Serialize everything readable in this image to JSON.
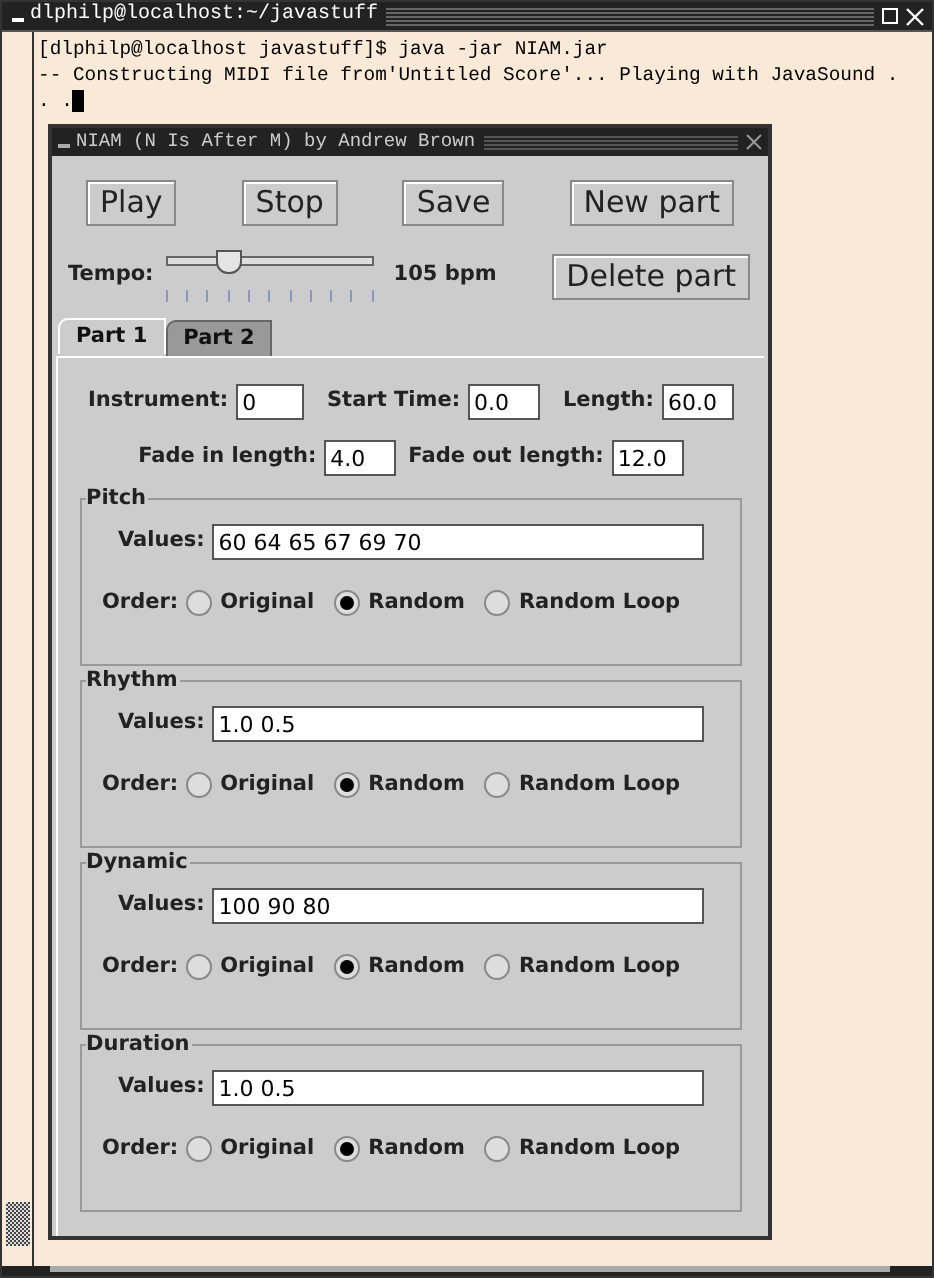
{
  "terminal": {
    "title": "dlphilp@localhost:~/javastuff",
    "lines": [
      "[dlphilp@localhost javastuff]$ java -jar NIAM.jar",
      "-- Constructing MIDI file from'Untitled Score'... Playing with JavaSound .",
      ". ."
    ]
  },
  "app": {
    "title": "NIAM (N Is After M) by Andrew Brown",
    "buttons": [
      "Play",
      "Stop",
      "Save",
      "New part"
    ],
    "tempo": {
      "label": "Tempo:",
      "level": 0.3,
      "reading": "105 bpm"
    },
    "delete_button": "Delete part",
    "tabs": [
      {
        "label": "Part 1",
        "selected": true
      },
      {
        "label": "Part 2",
        "selected": false
      }
    ],
    "fields_row_1": [
      {
        "label": "Instrument:",
        "value": "0"
      },
      {
        "label": "Start Time:",
        "value": "0.0"
      },
      {
        "label": "Length:",
        "value": "60.0"
      }
    ],
    "fields_row_2": [
      {
        "label": "Fade in length:",
        "value": "4.0"
      },
      {
        "label": "Fade out length:",
        "value": "12.0"
      }
    ],
    "sections": [
      {
        "title": "Pitch",
        "values_label": "Values:",
        "values": "60 64 65 67 69 70",
        "order_label": "Order:",
        "options": [
          {
            "label": "Original",
            "selected": false
          },
          {
            "label": "Random",
            "selected": true
          },
          {
            "label": "Random Loop",
            "selected": false
          }
        ]
      },
      {
        "title": "Rhythm",
        "values_label": "Values:",
        "values": "1.0 0.5",
        "order_label": "Order:",
        "options": [
          {
            "label": "Original",
            "selected": false
          },
          {
            "label": "Random",
            "selected": true
          },
          {
            "label": "Random Loop",
            "selected": false
          }
        ]
      },
      {
        "title": "Dynamic",
        "values_label": "Values:",
        "values": "100 90 80",
        "order_label": "Order:",
        "options": [
          {
            "label": "Original",
            "selected": false
          },
          {
            "label": "Random",
            "selected": true
          },
          {
            "label": "Random Loop",
            "selected": false
          }
        ]
      },
      {
        "title": "Duration",
        "values_label": "Values:",
        "values": "1.0 0.5",
        "order_label": "Order:",
        "options": [
          {
            "label": "Original",
            "selected": false
          },
          {
            "label": "Random",
            "selected": true
          },
          {
            "label": "Random Loop",
            "selected": false
          }
        ]
      }
    ]
  }
}
